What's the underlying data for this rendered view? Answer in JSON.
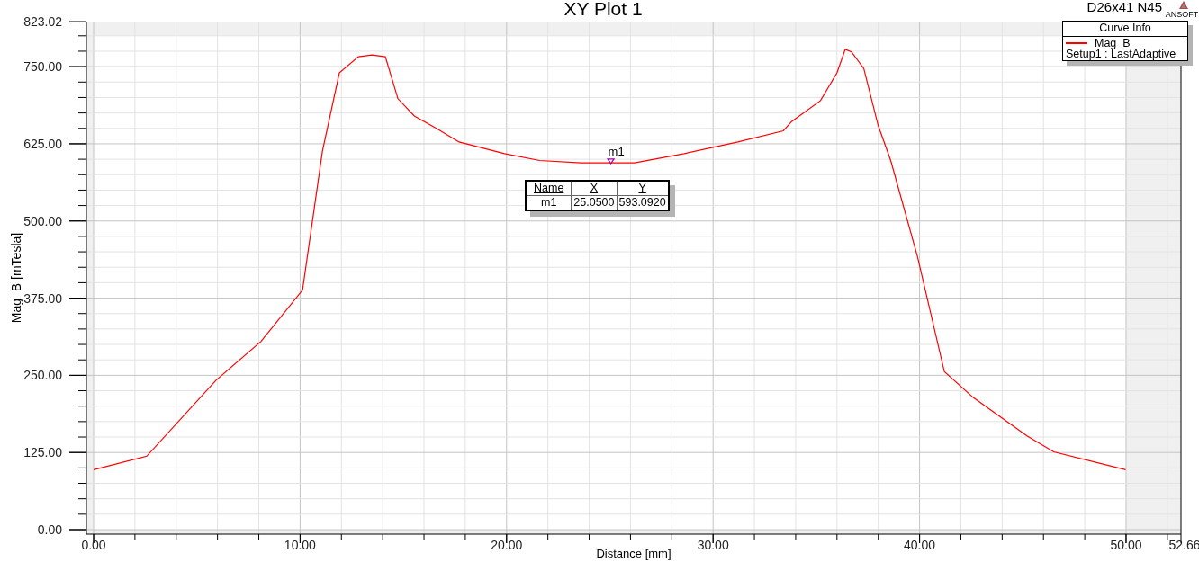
{
  "chart": {
    "subtitle": "D26x41 N45",
    "logo_text": "ANSOFT",
    "chart_data": {
      "type": "line",
      "title": "XY Plot 1",
      "xlabel": "Distance [mm]",
      "ylabel": "Mag_B [mTesla]",
      "grid": true,
      "x": [
        0,
        2.57,
        5.93,
        8.11,
        10.12,
        11.08,
        11.9,
        12.82,
        13.48,
        14.13,
        14.74,
        15.53,
        16.6,
        17.7,
        19.9,
        21.6,
        23.6,
        26.2,
        28.6,
        31.2,
        33.4,
        33.8,
        35.2,
        36.0,
        36.4,
        36.7,
        37.3,
        37.99,
        38.6,
        39.9,
        41.2,
        42.6,
        45.2,
        46.5,
        49.98
      ],
      "series": [
        {
          "name": "Mag_B",
          "color": "#ff0000",
          "values": [
            97,
            119,
            242,
            305,
            388,
            613,
            740,
            766,
            769,
            766,
            698,
            670,
            650,
            628,
            609,
            598,
            594,
            594,
            609,
            628,
            646,
            661,
            695,
            740,
            778,
            774,
            747,
            655,
            598,
            442,
            256,
            214,
            152,
            126,
            97
          ]
        }
      ],
      "xlim": [
        0,
        52.66
      ],
      "ylim": [
        0,
        823.02
      ],
      "xticks": [
        {
          "value": 0,
          "label": "0.00"
        },
        {
          "value": 10,
          "label": "10.00"
        },
        {
          "value": 20,
          "label": "20.00"
        },
        {
          "value": 30,
          "label": "30.00"
        },
        {
          "value": 40,
          "label": "40.00"
        },
        {
          "value": 50,
          "label": "50.00"
        },
        {
          "value": 52.66,
          "label": "52.66"
        }
      ],
      "yticks": [
        {
          "value": 0,
          "label": "0.00"
        },
        {
          "value": 125,
          "label": "125.00"
        },
        {
          "value": 250,
          "label": "250.00"
        },
        {
          "value": 375,
          "label": "375.00"
        },
        {
          "value": 500,
          "label": "500.00"
        },
        {
          "value": 625,
          "label": "625.00"
        },
        {
          "value": 750,
          "label": "750.00"
        },
        {
          "value": 823.02,
          "label": "823.02"
        }
      ]
    },
    "marker": {
      "label": "m1"
    },
    "legend": {
      "title": "Curve Info",
      "entries": [
        {
          "source": "Setup1 : LastAdaptive"
        }
      ]
    },
    "marker_table": {
      "columns": [
        "Name",
        "X",
        "Y"
      ],
      "rows": [
        [
          "m1",
          "25.0500",
          "593.0920"
        ]
      ]
    }
  }
}
